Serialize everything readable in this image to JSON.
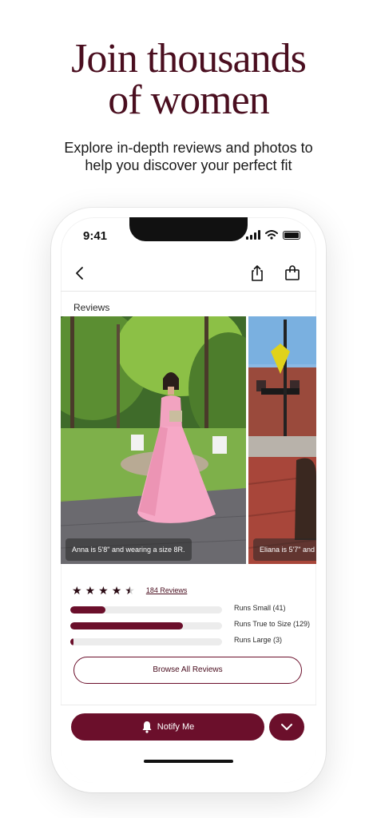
{
  "promo": {
    "headline_line1": "Join thousands",
    "headline_line2": "of women",
    "subhead_line1": "Explore in-depth reviews and photos to",
    "subhead_line2": "help you discover your perfect fit"
  },
  "status_bar": {
    "time": "9:41",
    "icons": [
      "signal-icon",
      "wifi-icon",
      "battery-icon"
    ]
  },
  "navbar": {
    "icons": [
      "back-icon",
      "share-icon",
      "bag-icon"
    ]
  },
  "reviews": {
    "section_label": "Reviews",
    "photos": [
      {
        "caption": "Anna is 5'8\" and wearing a size 8R."
      },
      {
        "caption": "Eliana is 5'7\" and"
      }
    ],
    "rating": 4.5,
    "rating_max": 5,
    "review_count_label": "184 Reviews",
    "fit": [
      {
        "label": "Runs Small (41)",
        "fraction": 0.23
      },
      {
        "label": "Runs True to Size (129)",
        "fraction": 0.74
      },
      {
        "label": "Runs Large (3)",
        "fraction": 0.02
      }
    ],
    "browse_label": "Browse All Reviews"
  },
  "bottom_bar": {
    "notify_label": "Notify Me",
    "icons": [
      "bell-icon",
      "chevron-down-icon"
    ]
  },
  "colors": {
    "brand": "#6b0f2b",
    "headline": "#4a0e1f"
  }
}
